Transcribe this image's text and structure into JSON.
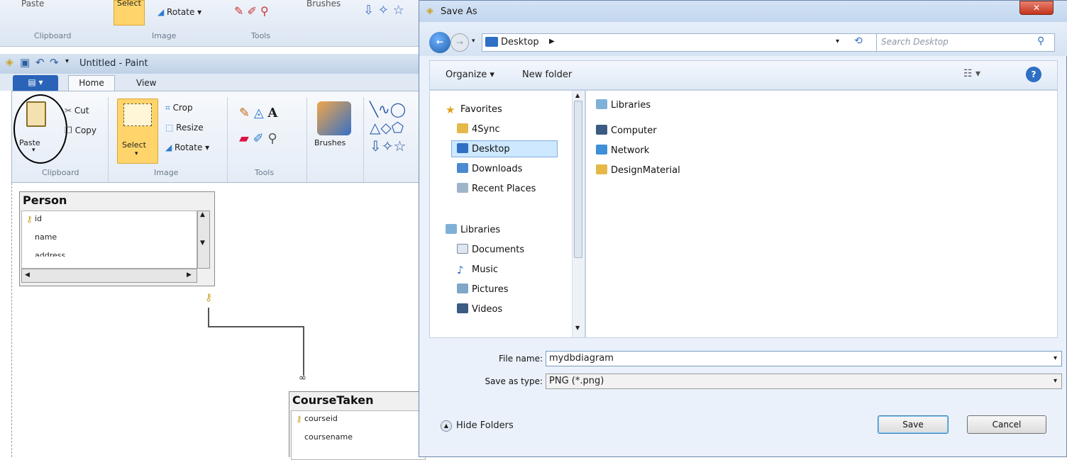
{
  "paint_back": {
    "top_labels": {
      "rotate": "Rotate",
      "clipboard": "Clipboard",
      "image": "Image",
      "tools": "Tools",
      "paste": "Paste",
      "select": "Select",
      "brushes": "Brushes"
    },
    "title": "Untitled - Paint",
    "tabs": {
      "home": "Home",
      "view": "View"
    },
    "ribbon": {
      "paste": "Paste",
      "cut": "Cut",
      "copy": "Copy",
      "select": "Select",
      "crop": "Crop",
      "resize": "Resize",
      "rotate": "Rotate",
      "brushes": "Brushes",
      "groups": {
        "clipboard": "Clipboard",
        "image": "Image",
        "tools": "Tools"
      }
    }
  },
  "diagram": {
    "person": {
      "title": "Person",
      "rows": [
        "id",
        "name",
        "address"
      ]
    },
    "coursetaken": {
      "title": "CourseTaken",
      "rows": [
        "courseid",
        "coursename"
      ]
    }
  },
  "dialog": {
    "title": "Save As",
    "address": "Desktop",
    "search_placeholder": "Search Desktop",
    "organize": "Organize",
    "new_folder": "New folder",
    "nav_items": [
      "Favorites",
      "4Sync",
      "Desktop",
      "Downloads",
      "Recent Places",
      "Libraries",
      "Documents",
      "Music",
      "Pictures",
      "Videos"
    ],
    "files": [
      "Libraries",
      "Computer",
      "Network",
      "DesignMaterial"
    ],
    "file_name_label": "File name:",
    "file_name_value": "mydbdiagram",
    "save_type_label": "Save as type:",
    "save_type_value": "PNG (*.png)",
    "hide_folders": "Hide Folders",
    "save": "Save",
    "cancel": "Cancel"
  },
  "colors": {
    "accent": "#1f5fa8",
    "selected": "#cde8ff",
    "select_highlight": "#ffd56b"
  }
}
